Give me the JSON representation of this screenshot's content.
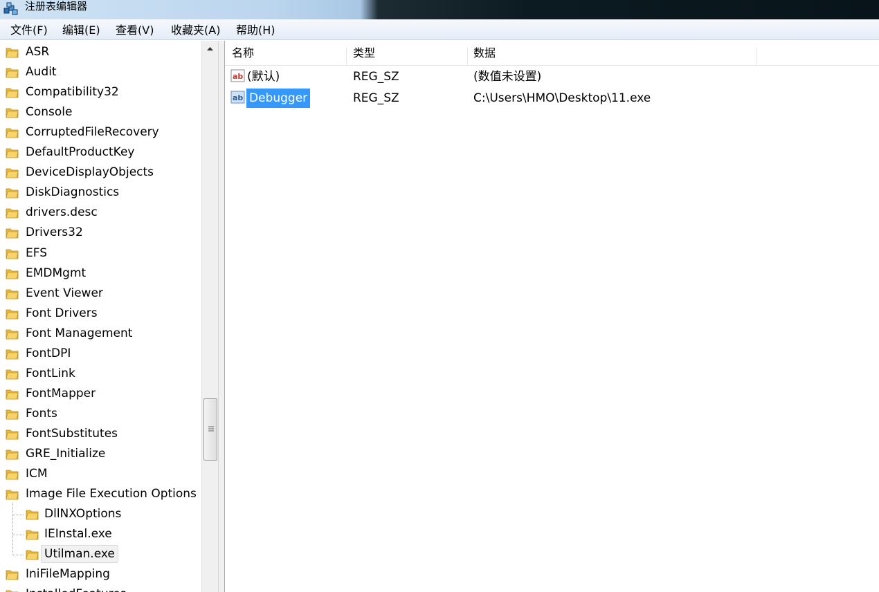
{
  "window": {
    "title": "注册表编辑器",
    "icon": "registry-editor-icon"
  },
  "menu": [
    "文件(F)",
    "编辑(E)",
    "查看(V)",
    "收藏夹(A)",
    "帮助(H)"
  ],
  "tree": [
    {
      "label": "ASR",
      "level": 0
    },
    {
      "label": "Audit",
      "level": 0
    },
    {
      "label": "Compatibility32",
      "level": 0
    },
    {
      "label": "Console",
      "level": 0
    },
    {
      "label": "CorruptedFileRecovery",
      "level": 0
    },
    {
      "label": "DefaultProductKey",
      "level": 0
    },
    {
      "label": "DeviceDisplayObjects",
      "level": 0
    },
    {
      "label": "DiskDiagnostics",
      "level": 0
    },
    {
      "label": "drivers.desc",
      "level": 0
    },
    {
      "label": "Drivers32",
      "level": 0
    },
    {
      "label": "EFS",
      "level": 0
    },
    {
      "label": "EMDMgmt",
      "level": 0
    },
    {
      "label": "Event Viewer",
      "level": 0
    },
    {
      "label": "Font Drivers",
      "level": 0
    },
    {
      "label": "Font Management",
      "level": 0
    },
    {
      "label": "FontDPI",
      "level": 0
    },
    {
      "label": "FontLink",
      "level": 0
    },
    {
      "label": "FontMapper",
      "level": 0
    },
    {
      "label": "Fonts",
      "level": 0
    },
    {
      "label": "FontSubstitutes",
      "level": 0
    },
    {
      "label": "GRE_Initialize",
      "level": 0
    },
    {
      "label": "ICM",
      "level": 0
    },
    {
      "label": "Image File Execution Options",
      "level": 0
    },
    {
      "label": "DllNXOptions",
      "level": 1
    },
    {
      "label": "IEInstal.exe",
      "level": 1
    },
    {
      "label": "Utilman.exe",
      "level": 1,
      "selected": true
    },
    {
      "label": "IniFileMapping",
      "level": 0
    },
    {
      "label": "InstalledFeatures",
      "level": 0
    }
  ],
  "columns": [
    "名称",
    "类型",
    "数据"
  ],
  "values": [
    {
      "name": "(默认)",
      "type": "REG_SZ",
      "data": "(数值未设置)",
      "icon": "string-value-icon",
      "selected": false
    },
    {
      "name": "Debugger",
      "type": "REG_SZ",
      "data": "C:\\Users\\HMO\\Desktop\\11.exe",
      "icon": "string-value-icon",
      "selected": true
    }
  ],
  "colors": {
    "selection": "#3399ff",
    "folder": "#f2c649"
  }
}
